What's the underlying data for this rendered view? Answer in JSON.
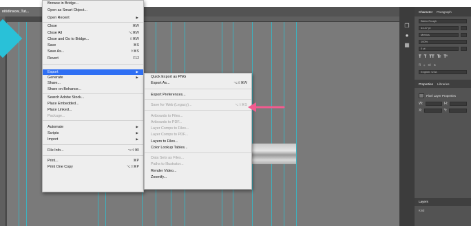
{
  "document": {
    "tab_title": "nitidinsow_Tut..."
  },
  "colors": {
    "guide": "#36b7c7",
    "highlight": "#2f6ff3",
    "annotation": "#f25b8f"
  },
  "file_menu": {
    "items": [
      {
        "label": "Browse in Bridge...",
        "shortcut": "",
        "submenu": false,
        "disabled": false
      },
      {
        "label": "Open as Smart Object...",
        "shortcut": "",
        "submenu": false,
        "disabled": false
      },
      {
        "label": "Open Recent",
        "shortcut": "",
        "submenu": true,
        "disabled": false
      },
      {
        "label": "Close",
        "shortcut": "⌘W",
        "submenu": false,
        "disabled": false
      },
      {
        "label": "Close All",
        "shortcut": "⌥⌘W",
        "submenu": false,
        "disabled": false
      },
      {
        "label": "Close and Go to Bridge...",
        "shortcut": "⇧⌘W",
        "submenu": false,
        "disabled": false
      },
      {
        "label": "Save",
        "shortcut": "⌘S",
        "submenu": false,
        "disabled": false
      },
      {
        "label": "Save As...",
        "shortcut": "⇧⌘S",
        "submenu": false,
        "disabled": false
      },
      {
        "label": "Revert",
        "shortcut": "F12",
        "submenu": false,
        "disabled": false
      },
      {
        "label": "Export",
        "shortcut": "",
        "submenu": true,
        "disabled": false,
        "selected": true
      },
      {
        "label": "Generate",
        "shortcut": "",
        "submenu": true,
        "disabled": false
      },
      {
        "label": "Share...",
        "shortcut": "",
        "submenu": false,
        "disabled": false
      },
      {
        "label": "Share on Behance...",
        "shortcut": "",
        "submenu": false,
        "disabled": false
      },
      {
        "label": "Search Adobe Stock...",
        "shortcut": "",
        "submenu": false,
        "disabled": false
      },
      {
        "label": "Place Embedded...",
        "shortcut": "",
        "submenu": false,
        "disabled": false
      },
      {
        "label": "Place Linked...",
        "shortcut": "",
        "submenu": false,
        "disabled": false
      },
      {
        "label": "Package...",
        "shortcut": "",
        "submenu": false,
        "disabled": true
      },
      {
        "label": "Automate",
        "shortcut": "",
        "submenu": true,
        "disabled": false
      },
      {
        "label": "Scripts",
        "shortcut": "",
        "submenu": true,
        "disabled": false
      },
      {
        "label": "Import",
        "shortcut": "",
        "submenu": true,
        "disabled": false
      },
      {
        "label": "File Info...",
        "shortcut": "⌥⇧⌘I",
        "submenu": false,
        "disabled": false
      },
      {
        "label": "Print...",
        "shortcut": "⌘P",
        "submenu": false,
        "disabled": false
      },
      {
        "label": "Print One Copy",
        "shortcut": "⌥⇧⌘P",
        "submenu": false,
        "disabled": false
      }
    ]
  },
  "export_submenu": {
    "items": [
      {
        "label": "Quick Export as PNG",
        "shortcut": "",
        "disabled": false
      },
      {
        "label": "Export As...",
        "shortcut": "⌥⇧⌘W",
        "disabled": false
      },
      {
        "label": "Export Preferences...",
        "shortcut": "",
        "disabled": false
      },
      {
        "label": "Save for Web (Legacy)...",
        "shortcut": "⌥⇧⌘S",
        "disabled": true
      },
      {
        "label": "Artboards to Files...",
        "shortcut": "",
        "disabled": true
      },
      {
        "label": "Artboards to PDF...",
        "shortcut": "",
        "disabled": true
      },
      {
        "label": "Layer Comps to Files...",
        "shortcut": "",
        "disabled": true
      },
      {
        "label": "Layer Comps to PDF...",
        "shortcut": "",
        "disabled": true
      },
      {
        "label": "Layers to Files...",
        "shortcut": "",
        "disabled": false
      },
      {
        "label": "Color Lookup Tables...",
        "shortcut": "",
        "disabled": false
      },
      {
        "label": "Data Sets as Files...",
        "shortcut": "",
        "disabled": true
      },
      {
        "label": "Paths to Illustrator...",
        "shortcut": "",
        "disabled": true
      },
      {
        "label": "Render Video...",
        "shortcut": "",
        "disabled": false
      },
      {
        "label": "Zoomify...",
        "shortcut": "",
        "disabled": false
      }
    ]
  },
  "character_panel": {
    "tabs": [
      "Character",
      "Paragraph"
    ],
    "font_family": "Bistro Rough",
    "font_size": "44.47 pt",
    "kerning": "Metrics",
    "tracking_scale": "100%",
    "leading": "0 pt",
    "baseline": "Auto",
    "style_buttons": [
      "T",
      "T",
      "TT",
      "Tr",
      "T¹",
      "T₁",
      "T",
      "Ŧ"
    ],
    "language": "English: USA"
  },
  "properties_panel": {
    "tabs": [
      "Properties",
      "Libraries"
    ],
    "layer_type": "Pixel Layer Properties",
    "w_label": "W:",
    "x_label": "X:",
    "h_label": "H:",
    "y_label": "Y:"
  },
  "layers_panel": {
    "title": "Layers",
    "filter": "Kind"
  }
}
